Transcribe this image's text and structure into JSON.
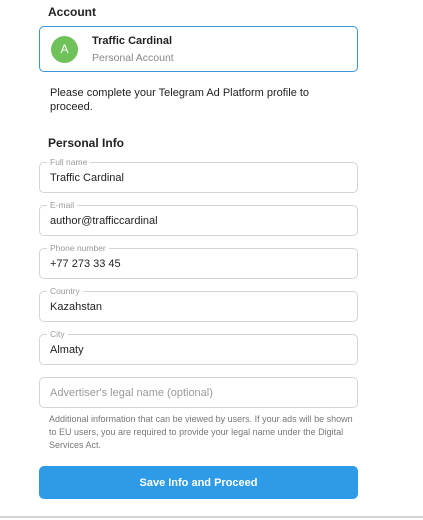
{
  "account": {
    "section_title": "Account",
    "avatar_letter": "A",
    "avatar_color": "#6fc25a",
    "name": "Traffic Cardinal",
    "type": "Personal Account"
  },
  "notice": "Please complete your Telegram Ad Platform profile to proceed.",
  "personal_info": {
    "section_title": "Personal Info",
    "fields": {
      "full_name": {
        "label": "Full name",
        "value": "Traffic Cardinal"
      },
      "email": {
        "label": "E-mail",
        "value": "author@trafficcardinal"
      },
      "phone": {
        "label": "Phone number",
        "value": "+77 273 33 45"
      },
      "country": {
        "label": "Country",
        "value": "Kazahstan"
      },
      "city": {
        "label": "City",
        "value": "Almaty"
      },
      "legal_name": {
        "placeholder": "Advertiser's legal name (optional)",
        "value": ""
      }
    },
    "helper_text": "Additional information that can be viewed by users. If your ads will be shown to EU users, you are required to provide your legal name under the Digital Services Act."
  },
  "submit_label": "Save Info and Proceed",
  "colors": {
    "accent": "#2e9be8",
    "selected_border": "#3a95d9"
  }
}
